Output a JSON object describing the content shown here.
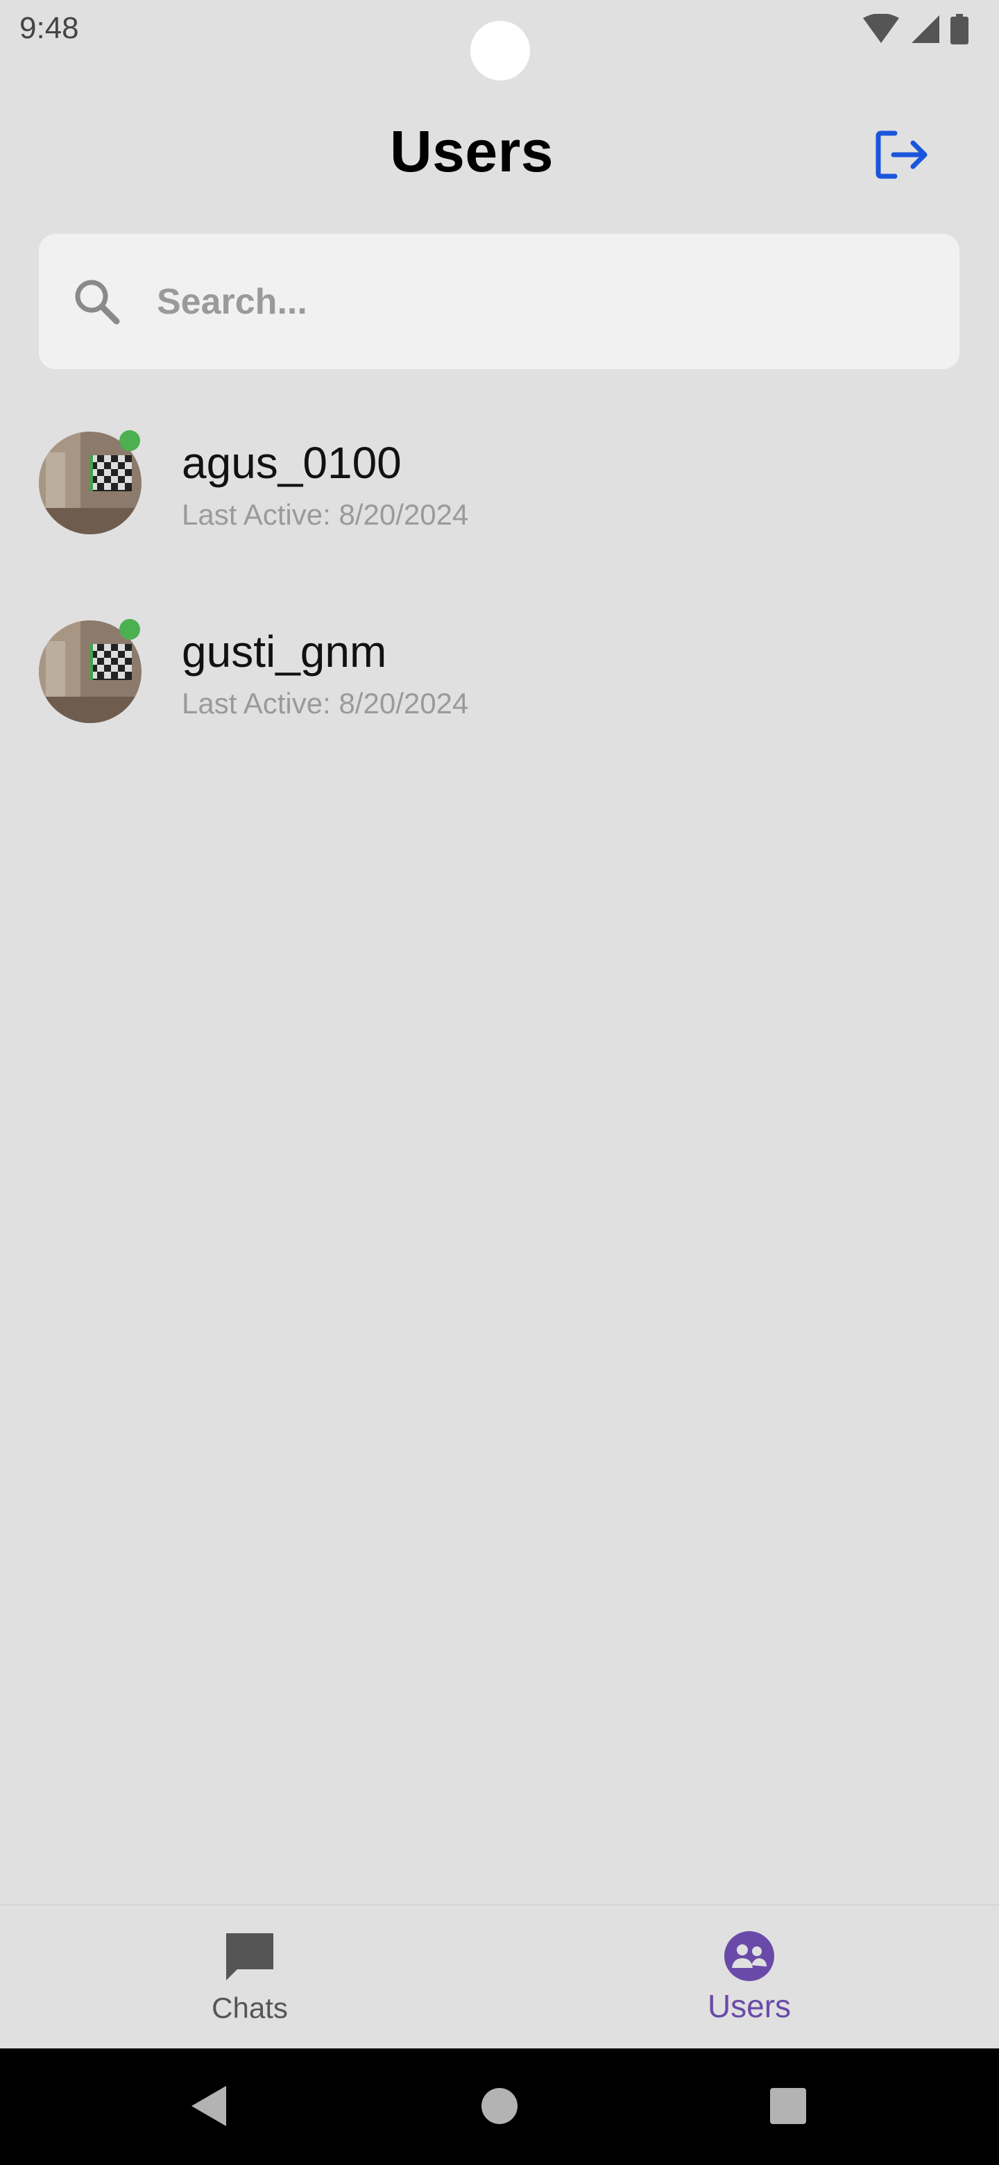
{
  "status_bar": {
    "time": "9:48",
    "icons": [
      "wifi-icon",
      "signal-icon",
      "battery-icon"
    ]
  },
  "header": {
    "title": "Users",
    "logout_icon": "logout-icon",
    "accent_color": "#1a56db"
  },
  "search": {
    "placeholder": "Search...",
    "value": "",
    "icon": "search-icon"
  },
  "users": [
    {
      "name": "agus_0100",
      "last_active": "Last Active: 8/20/2024",
      "online": true
    },
    {
      "name": "gusti_gnm",
      "last_active": "Last Active: 8/20/2024",
      "online": true
    }
  ],
  "bottom_nav": {
    "items": [
      {
        "label": "Chats",
        "icon": "chat-icon",
        "active": false
      },
      {
        "label": "Users",
        "icon": "users-icon",
        "active": true
      }
    ],
    "active_color": "#6a4aa8"
  },
  "system_nav": [
    "back-icon",
    "home-icon",
    "recents-icon"
  ]
}
